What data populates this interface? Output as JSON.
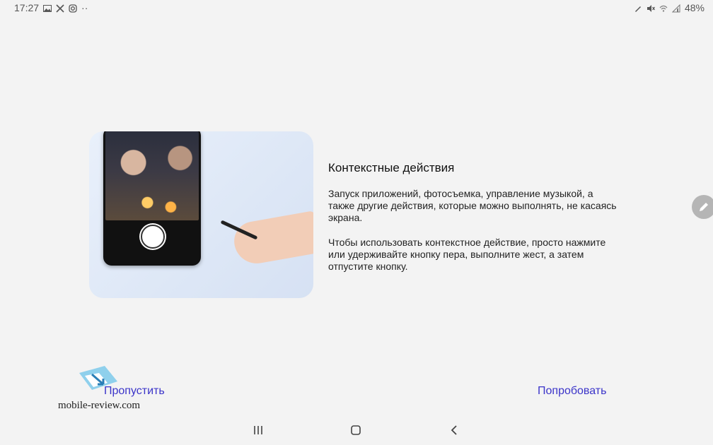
{
  "status_bar": {
    "time": "17:27",
    "dots": "··",
    "battery": "48%",
    "left_icons": [
      "gallery-icon",
      "missed-call-icon",
      "instagram-icon"
    ],
    "right_icons": [
      "pen-icon",
      "mute-icon",
      "wifi-icon",
      "signal-icon"
    ]
  },
  "content": {
    "title": "Контекстные действия",
    "paragraph1": "Запуск приложений, фотосъемка, управление музыкой, а также другие действия, которые можно выполнять, не касаясь экрана.",
    "paragraph2": "Чтобы использовать контекстное действие, просто нажмите или удерживайте кнопку пера, выполните жест, а затем отпустите кнопку."
  },
  "buttons": {
    "skip": "Пропустить",
    "try": "Попробовать"
  },
  "watermark": {
    "text": "mobile-review.com"
  },
  "colors": {
    "accent": "#3b34c9",
    "background": "#f3f3f3"
  }
}
